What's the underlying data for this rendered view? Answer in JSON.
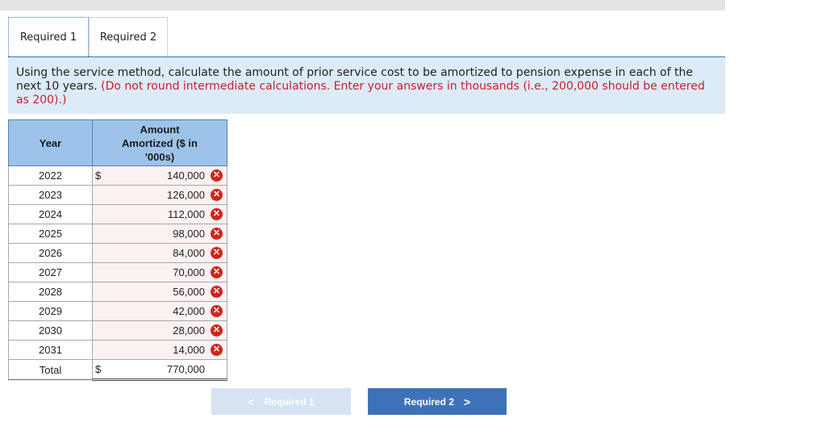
{
  "tabs": [
    {
      "label": "Required 1"
    },
    {
      "label": "Required 2"
    }
  ],
  "instructions": {
    "text": "Using the service method, calculate the amount of prior service cost to be amortized to pension expense in each of the next 10 years.",
    "note": "(Do not round intermediate calculations. Enter your answers in thousands (i.e., 200,000 should be entered as 200).)"
  },
  "table": {
    "headers": {
      "year": "Year",
      "amount": "Amount Amortized ($ in '000s)"
    },
    "currency_symbol": "$",
    "rows": [
      {
        "year": "2022",
        "amount": "140,000"
      },
      {
        "year": "2023",
        "amount": "126,000"
      },
      {
        "year": "2024",
        "amount": "112,000"
      },
      {
        "year": "2025",
        "amount": "98,000"
      },
      {
        "year": "2026",
        "amount": "84,000"
      },
      {
        "year": "2027",
        "amount": "70,000"
      },
      {
        "year": "2028",
        "amount": "56,000"
      },
      {
        "year": "2029",
        "amount": "42,000"
      },
      {
        "year": "2030",
        "amount": "28,000"
      },
      {
        "year": "2031",
        "amount": "14,000"
      }
    ],
    "total": {
      "label": "Total",
      "amount": "770,000"
    },
    "incorrect_icon": "incorrect-x-icon",
    "incorrect_color": "#d0241c"
  },
  "nav": {
    "prev_label": "Required 1",
    "next_label": "Required 2",
    "prev_icon": "chevron-left-icon",
    "next_icon": "chevron-right-icon"
  },
  "colors": {
    "header_bg": "#9ec3ea",
    "instruction_bg": "#ddeaf7",
    "next_button_bg": "#3e72b8",
    "note_text": "#c8202f"
  }
}
